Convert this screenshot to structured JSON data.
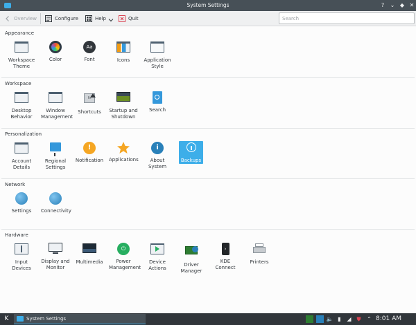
{
  "window": {
    "title": "System Settings"
  },
  "titlebar_buttons": [
    {
      "name": "help-icon",
      "glyph": "?"
    },
    {
      "name": "minimize-icon",
      "glyph": "⌄"
    },
    {
      "name": "maximize-icon",
      "glyph": "◆"
    },
    {
      "name": "close-icon",
      "glyph": "✕"
    }
  ],
  "toolbar": {
    "overview": "Overview",
    "configure": "Configure",
    "help": "Help",
    "quit": "Quit",
    "search_placeholder": "Search"
  },
  "sections": [
    {
      "title": "Appearance",
      "items": [
        {
          "label": "Workspace Theme",
          "icon": "workspace-theme-icon"
        },
        {
          "label": "Color",
          "icon": "color-icon"
        },
        {
          "label": "Font",
          "icon": "font-icon"
        },
        {
          "label": "Icons",
          "icon": "icons-icon"
        },
        {
          "label": "Application Style",
          "icon": "application-style-icon"
        }
      ]
    },
    {
      "title": "Workspace",
      "items": [
        {
          "label": "Desktop Behavior",
          "icon": "desktop-behavior-icon"
        },
        {
          "label": "Window Management",
          "icon": "window-management-icon"
        },
        {
          "label": "Shortcuts",
          "icon": "shortcuts-icon"
        },
        {
          "label": "Startup and Shutdown",
          "icon": "startup-shutdown-icon"
        },
        {
          "label": "Search",
          "icon": "search-icon"
        }
      ]
    },
    {
      "title": "Personalization",
      "items": [
        {
          "label": "Account Details",
          "icon": "account-details-icon"
        },
        {
          "label": "Regional Settings",
          "icon": "regional-settings-icon"
        },
        {
          "label": "Notification",
          "icon": "notification-icon"
        },
        {
          "label": "Applications",
          "icon": "applications-icon"
        },
        {
          "label": "About System",
          "icon": "about-system-icon"
        },
        {
          "label": "Backups",
          "icon": "backups-icon"
        }
      ]
    },
    {
      "title": "Network",
      "items": [
        {
          "label": "Settings",
          "icon": "network-settings-icon"
        },
        {
          "label": "Connectivity",
          "icon": "connectivity-icon"
        }
      ]
    },
    {
      "title": "Hardware",
      "items": [
        {
          "label": "Input Devices",
          "icon": "input-devices-icon"
        },
        {
          "label": "Display and Monitor",
          "icon": "display-monitor-icon"
        },
        {
          "label": "Multimedia",
          "icon": "multimedia-icon"
        },
        {
          "label": "Power Management",
          "icon": "power-management-icon"
        },
        {
          "label": "Device Actions",
          "icon": "device-actions-icon"
        },
        {
          "label": "Driver Manager",
          "icon": "driver-manager-icon"
        },
        {
          "label": "KDE Connect",
          "icon": "kde-connect-icon"
        },
        {
          "label": "Printers",
          "icon": "printers-icon"
        }
      ]
    }
  ],
  "taskbar": {
    "task_label": "System Settings",
    "clock": "8:01 AM"
  },
  "colors": {
    "accent": "#3daee9",
    "titlebar": "#475057",
    "taskbar": "#31363b"
  }
}
